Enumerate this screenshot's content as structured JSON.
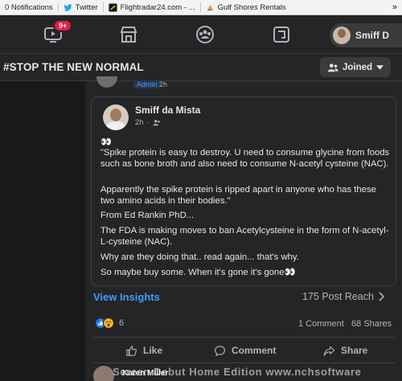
{
  "bookmarks": [
    {
      "label": "0 Notifications",
      "icon": "notification-icon"
    },
    {
      "label": "Twitter",
      "icon": "twitter-icon"
    },
    {
      "label": "Flightradar24.com - ...",
      "icon": "flightradar-icon"
    },
    {
      "label": "Gulf Shores Rentals",
      "icon": "gulf-shores-icon"
    }
  ],
  "nav": {
    "watch_badge": "9+",
    "profile_name": "Smiff D"
  },
  "group": {
    "title": "#STOP THE NEW NORMAL",
    "joined_label": "Joined"
  },
  "previous_post": {
    "role": "Admin",
    "time": "2h"
  },
  "shared_post": {
    "author": "Smiff da Mista",
    "time": "2h",
    "eyes": "👀",
    "paragraphs": [
      "\"Spike protein is easy to destroy. U need to consume glycine from foods such as bone broth and also need to consume N-acetyl cysteine (NAC).",
      "Apparently the spike protein is ripped apart in anyone who has these two amino acids in their bodies.\"",
      "From Ed Rankin PhD...",
      "The FDA is making moves to ban Acetylcysteine in the form of N-acetyl-L-cysteine (NAC).",
      "Why are they doing that.. read again... that's why.",
      "So maybe buy some. When it's gone it's gone👀"
    ]
  },
  "insights": {
    "view_label": "View Insights",
    "reach": "175 Post Reach"
  },
  "engagement": {
    "reaction_count": "6",
    "comments": "1 Comment",
    "shares": "68 Shares"
  },
  "actions": {
    "like": "Like",
    "comment": "Comment",
    "share": "Share"
  },
  "comment_preview": {
    "name": "Karen Miller",
    "text": "..."
  },
  "watermark": "Screen Debut Home Edition www.nchsoftware",
  "colors": {
    "accent": "#4599ff",
    "background": "#18191a",
    "card": "#242526",
    "badge": "#e41e3f"
  }
}
